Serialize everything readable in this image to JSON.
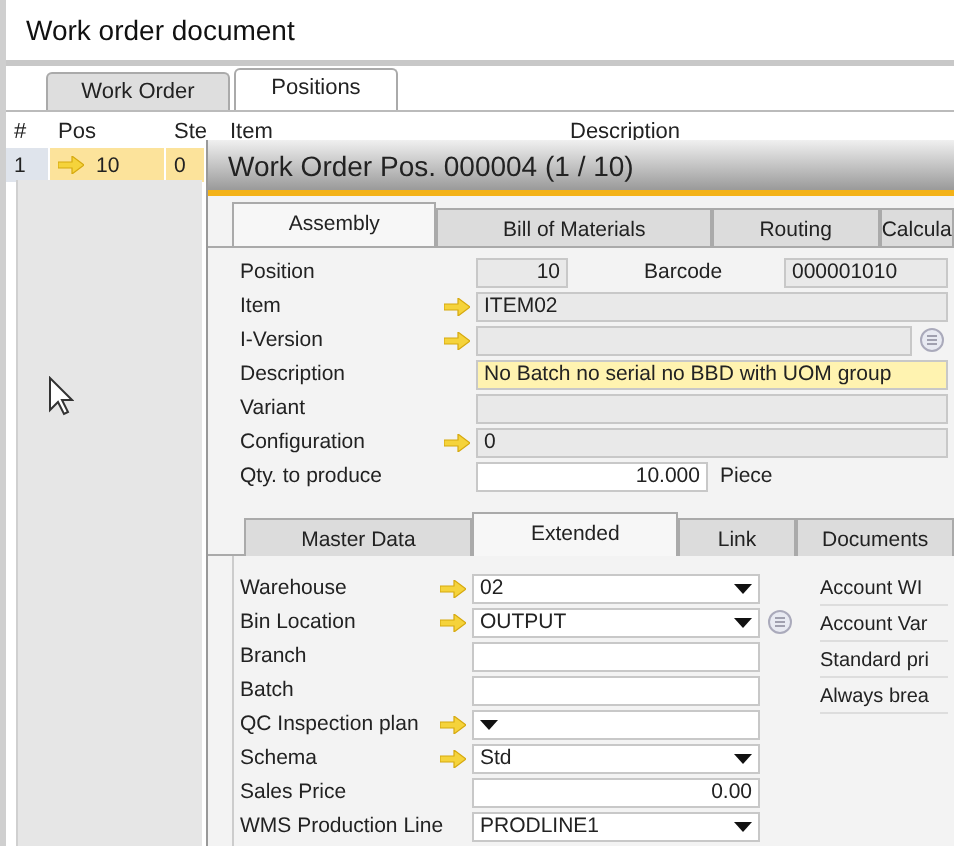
{
  "window": {
    "title": "Work order document"
  },
  "tabs": [
    {
      "label": "Work Order",
      "selected": false
    },
    {
      "label": "Positions",
      "selected": true
    }
  ],
  "grid": {
    "columns": [
      "#",
      "Pos",
      "Ste",
      "Item",
      "Description"
    ],
    "rows": [
      {
        "cells": [
          "1",
          "10",
          "0"
        ],
        "selected": true,
        "linked": true
      }
    ]
  },
  "dialog": {
    "title": "Work Order Pos. 000004 (1 / 10)",
    "tabs": [
      {
        "label": "Assembly",
        "selected": true
      },
      {
        "label": "Bill of Materials",
        "selected": false
      },
      {
        "label": "Routing",
        "selected": false
      },
      {
        "label": "Calcula",
        "selected": false
      }
    ],
    "fields": [
      {
        "kind": "pair",
        "label": "Position",
        "value": "10",
        "label2": "Barcode",
        "value2": "000001010",
        "readonly": true,
        "linked": false
      },
      {
        "kind": "text",
        "label": "Item",
        "value": "ITEM02",
        "readonly": true,
        "linked": true
      },
      {
        "kind": "text",
        "label": "I-Version",
        "readonly": true,
        "linked": true,
        "list_button": true
      },
      {
        "kind": "text",
        "label": "Description",
        "value": "No Batch no serial no BBD with UOM group",
        "focused": true,
        "linked": false
      },
      {
        "kind": "text",
        "label": "Variant",
        "readonly": true,
        "linked": false
      },
      {
        "kind": "text",
        "label": "Configuration",
        "value": "0",
        "readonly": true,
        "linked": true
      },
      {
        "kind": "number",
        "label": "Qty. to produce",
        "value": "10.000",
        "unit": "Piece",
        "readonly": false,
        "linked": false
      }
    ],
    "subtabs": [
      {
        "label": "Master Data",
        "selected": false
      },
      {
        "label": "Extended",
        "selected": true
      },
      {
        "label": "Link",
        "selected": false
      },
      {
        "label": "Documents",
        "selected": false
      }
    ],
    "extended_fields": [
      {
        "kind": "dropdown",
        "label": "Warehouse",
        "value": "02",
        "linked": true
      },
      {
        "kind": "dropdown",
        "label": "Bin Location",
        "value": "OUTPUT",
        "linked": true,
        "list_button": true
      },
      {
        "kind": "text",
        "label": "Branch",
        "linked": false
      },
      {
        "kind": "text",
        "label": "Batch",
        "linked": false
      },
      {
        "kind": "dropdown",
        "label": "QC Inspection plan",
        "linked": true
      },
      {
        "kind": "dropdown",
        "label": "Schema",
        "value": "Std",
        "linked": true
      },
      {
        "kind": "number",
        "label": "Sales Price",
        "value": "0.00",
        "linked": false
      },
      {
        "kind": "dropdown",
        "label": "WMS Production Line",
        "value": "PRODLINE1",
        "linked": false
      }
    ],
    "extended_labels": [
      "Account WI",
      "Account Var",
      "Standard pri",
      "Always brea"
    ]
  }
}
